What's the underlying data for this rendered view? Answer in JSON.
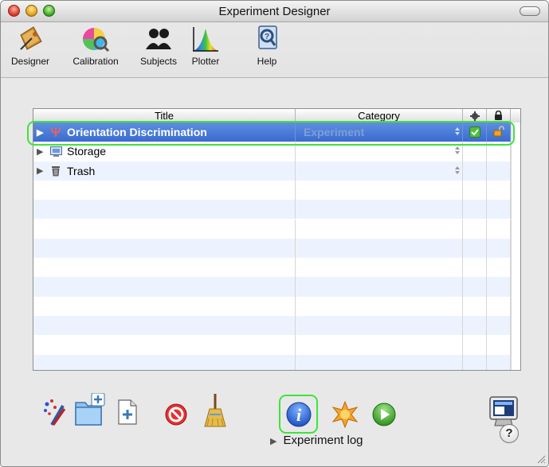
{
  "window": {
    "title": "Experiment Designer"
  },
  "toolbar": {
    "items": [
      {
        "label": "Designer",
        "icon": "designer-icon"
      },
      {
        "label": "Calibration",
        "icon": "calibration-icon"
      },
      {
        "label": "Subjects",
        "icon": "subjects-icon"
      },
      {
        "label": "Plotter",
        "icon": "plotter-icon"
      },
      {
        "label": "Help",
        "icon": "help-icon"
      }
    ]
  },
  "table": {
    "columns": {
      "title": "Title",
      "category": "Category"
    },
    "rows": [
      {
        "title": "Orientation Discrimination",
        "category": "Experiment",
        "selected": true,
        "enabled": true,
        "locked": false
      },
      {
        "title": "Storage",
        "category": ""
      },
      {
        "title": "Trash",
        "category": ""
      }
    ]
  },
  "footer": {
    "log_label": "Experiment log",
    "help_glyph": "?"
  },
  "colors": {
    "selection": "#3a6bd0",
    "highlight": "#3ee33e",
    "alt_row": "#edf3fe"
  }
}
